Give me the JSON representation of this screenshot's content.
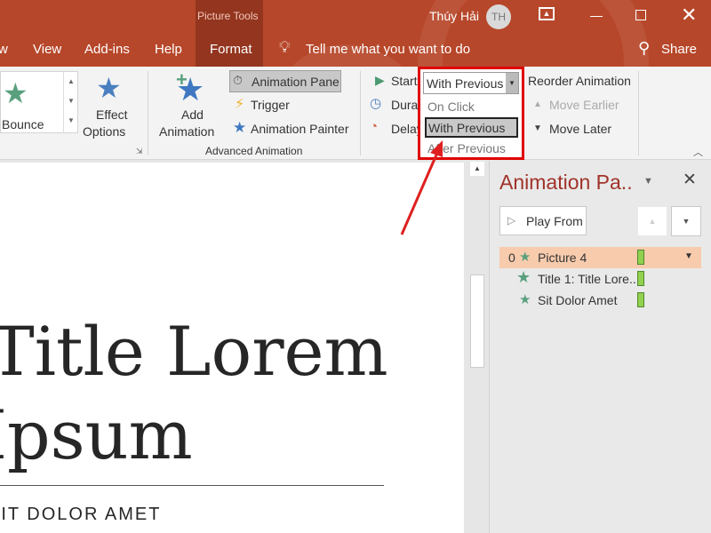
{
  "titlebar": {
    "context_tab_group": "Picture Tools",
    "user_name": "Thúy Hải",
    "user_initials": "TH"
  },
  "tabs": [
    {
      "label": "w"
    },
    {
      "label": "View"
    },
    {
      "label": "Add-ins"
    },
    {
      "label": "Help"
    },
    {
      "label": "Format"
    }
  ],
  "tell_me": "Tell me what you want to do",
  "share": "Share",
  "ribbon": {
    "gallery_item": "Bounce",
    "effect_options": [
      "Effect",
      "Options"
    ],
    "add_animation": [
      "Add",
      "Animation"
    ],
    "animation_pane": "Animation Pane",
    "trigger": "Trigger",
    "animation_painter": "Animation Painter",
    "group_advanced": "Advanced Animation",
    "start_label": "Start:",
    "duration_label": "Durati",
    "delay_label": "Delay:",
    "start_value": "With Previous",
    "start_options": [
      "On Click",
      "With Previous",
      "After Previous"
    ],
    "reorder_title": "Reorder Animation",
    "move_earlier": "Move Earlier",
    "move_later": "Move Later"
  },
  "slide": {
    "title_line1": "Title Lorem",
    "title_line2": "Ipsum",
    "subtitle": "SIT DOLOR AMET"
  },
  "pane": {
    "title": "Animation Pa..",
    "play_from": "Play From",
    "items": [
      {
        "index": "0",
        "label": "Picture 4"
      },
      {
        "index": "",
        "label": "Title 1: Title Lore..."
      },
      {
        "index": "",
        "label": "Sit Dolor Amet"
      }
    ]
  },
  "colors": {
    "accent": "#b7472a",
    "highlight": "#e00000",
    "selected_row": "#f8cbad"
  }
}
